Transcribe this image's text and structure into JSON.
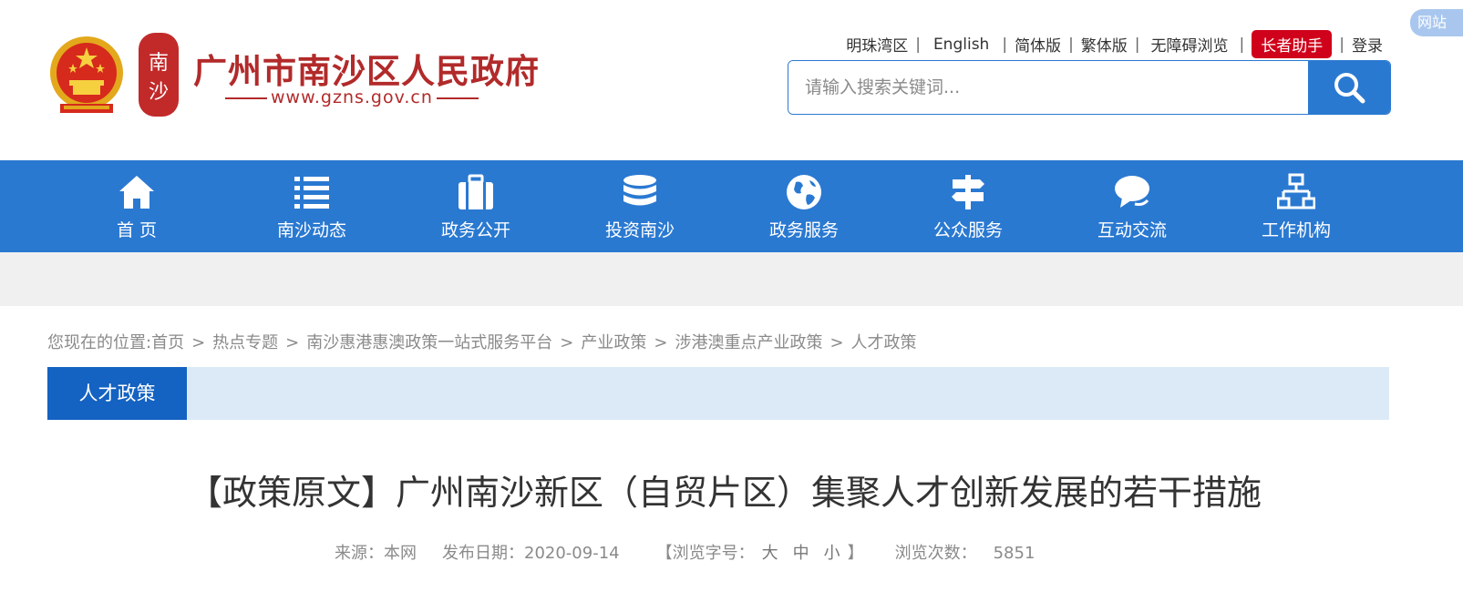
{
  "header": {
    "site_title": "广州市南沙区人民政府",
    "site_url": "www.gzns.gov.cn",
    "seal_text": "南沙"
  },
  "toplinks": {
    "items": [
      "明珠湾区",
      "English",
      "简体版",
      "繁体版",
      "无障碍浏览",
      "长者助手",
      "登录"
    ],
    "corner_badge": "网站"
  },
  "search": {
    "placeholder": "请输入搜索关键词..."
  },
  "nav": {
    "items": [
      {
        "label": "首 页",
        "icon": "home-icon"
      },
      {
        "label": "南沙动态",
        "icon": "list-icon"
      },
      {
        "label": "政务公开",
        "icon": "briefcase-icon"
      },
      {
        "label": "投资南沙",
        "icon": "coins-icon"
      },
      {
        "label": "政务服务",
        "icon": "globe-icon"
      },
      {
        "label": "公众服务",
        "icon": "signpost-icon"
      },
      {
        "label": "互动交流",
        "icon": "chat-icon"
      },
      {
        "label": "工作机构",
        "icon": "org-chart-icon"
      }
    ]
  },
  "breadcrumb": {
    "prefix": "您现在的位置:",
    "items": [
      "首页",
      "热点专题",
      "南沙惠港惠澳政策一站式服务平台",
      "产业政策",
      "涉港澳重点产业政策",
      "人才政策"
    ]
  },
  "section": {
    "tab_label": "人才政策"
  },
  "article": {
    "title": "【政策原文】广州南沙新区（自贸片区）集聚人才创新发展的若干措施",
    "source_label": "来源：本网",
    "date_label": "发布日期：2020-09-14",
    "font_size_label": "【浏览字号：",
    "font_sizes": [
      "大",
      "中",
      "小"
    ],
    "font_size_end": "】",
    "views_label": "浏览次数：",
    "views_count": "5851"
  },
  "colors": {
    "brand_blue": "#2a79d1",
    "tab_blue": "#1462c2",
    "title_red": "#b22a2a",
    "elder_red": "#d0021b"
  }
}
